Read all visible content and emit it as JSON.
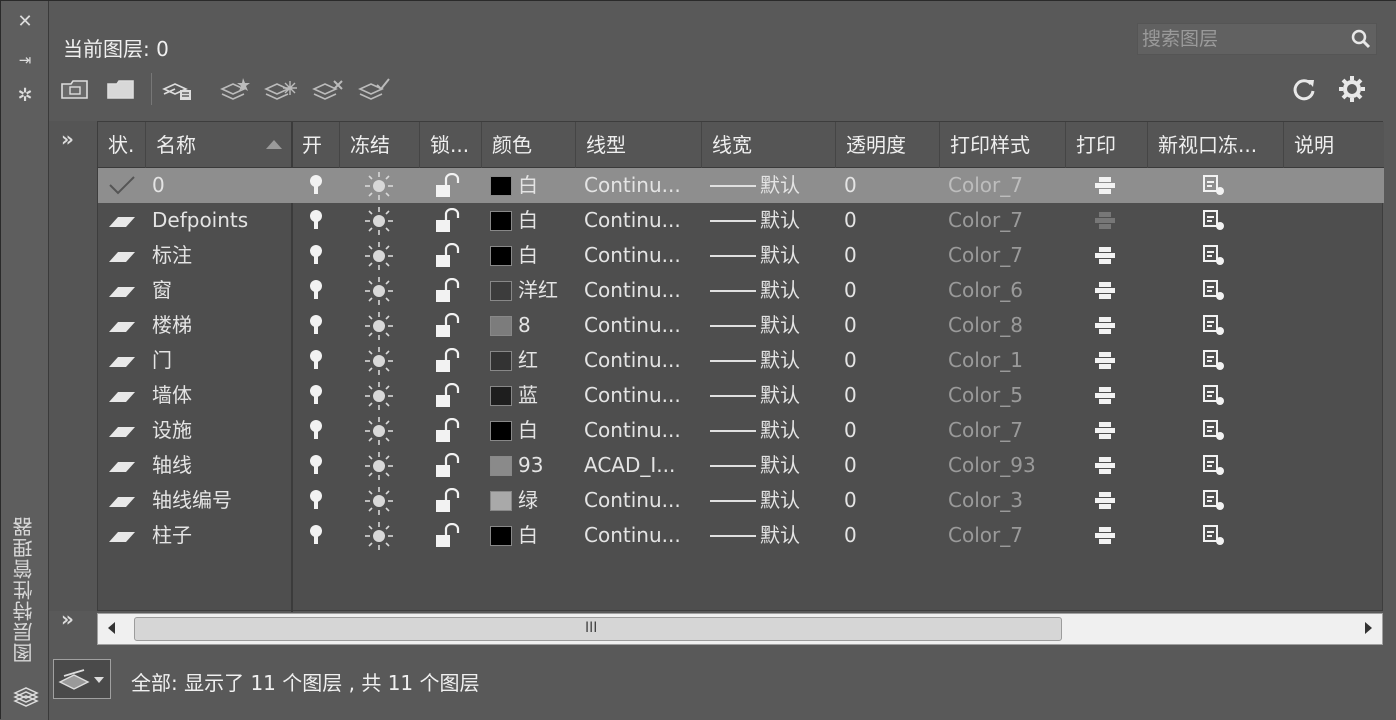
{
  "sidebar": {
    "title": "图层特性管理器",
    "close_glyph": "✕",
    "pin_glyph": "⇥",
    "settings_glyph": "✲"
  },
  "header": {
    "current_layer": "当前图层: 0"
  },
  "search": {
    "placeholder": "搜索图层",
    "value": ""
  },
  "tree": {
    "expand_glyph": "»"
  },
  "columns": {
    "status": "状.",
    "name": "名称",
    "on": "开",
    "freeze": "冻结",
    "lock": "锁...",
    "color": "颜色",
    "linetype": "线型",
    "lineweight": "线宽",
    "transparency": "透明度",
    "plot_style": "打印样式",
    "plot": "打印",
    "new_vp_freeze": "新视口冻...",
    "description": "说明"
  },
  "layers": [
    {
      "name": "0",
      "color_name": "白",
      "color_hex": "#000000",
      "linetype": "Continu...",
      "lineweight": "默认",
      "transparency": "0",
      "plot_style": "Color_7",
      "current": true
    },
    {
      "name": "Defpoints",
      "color_name": "白",
      "color_hex": "#000000",
      "linetype": "Continu...",
      "lineweight": "默认",
      "transparency": "0",
      "plot_style": "Color_7",
      "current": false
    },
    {
      "name": "标注",
      "color_name": "白",
      "color_hex": "#000000",
      "linetype": "Continu...",
      "lineweight": "默认",
      "transparency": "0",
      "plot_style": "Color_7",
      "current": false
    },
    {
      "name": "窗",
      "color_name": "洋红",
      "color_hex": "#3c3c3c",
      "linetype": "Continu...",
      "lineweight": "默认",
      "transparency": "0",
      "plot_style": "Color_6",
      "current": false
    },
    {
      "name": "楼梯",
      "color_name": "8",
      "color_hex": "#7c7c7c",
      "linetype": "Continu...",
      "lineweight": "默认",
      "transparency": "0",
      "plot_style": "Color_8",
      "current": false
    },
    {
      "name": "门",
      "color_name": "红",
      "color_hex": "#333333",
      "linetype": "Continu...",
      "lineweight": "默认",
      "transparency": "0",
      "plot_style": "Color_1",
      "current": false
    },
    {
      "name": "墙体",
      "color_name": "蓝",
      "color_hex": "#1e1e1e",
      "linetype": "Continu...",
      "lineweight": "默认",
      "transparency": "0",
      "plot_style": "Color_5",
      "current": false
    },
    {
      "name": "设施",
      "color_name": "白",
      "color_hex": "#000000",
      "linetype": "Continu...",
      "lineweight": "默认",
      "transparency": "0",
      "plot_style": "Color_7",
      "current": false
    },
    {
      "name": "轴线",
      "color_name": "93",
      "color_hex": "#8a8a8a",
      "linetype": "ACAD_I...",
      "lineweight": "默认",
      "transparency": "0",
      "plot_style": "Color_93",
      "current": false
    },
    {
      "name": "轴线编号",
      "color_name": "绿",
      "color_hex": "#a9a9a9",
      "linetype": "Continu...",
      "lineweight": "默认",
      "transparency": "0",
      "plot_style": "Color_3",
      "current": false
    },
    {
      "name": "柱子",
      "color_name": "白",
      "color_hex": "#000000",
      "linetype": "Continu...",
      "lineweight": "默认",
      "transparency": "0",
      "plot_style": "Color_7",
      "current": false
    }
  ],
  "scrollbar": {
    "grip": "III"
  },
  "status": {
    "text": "全部: 显示了 11 个图层 , 共 11 个图层"
  }
}
